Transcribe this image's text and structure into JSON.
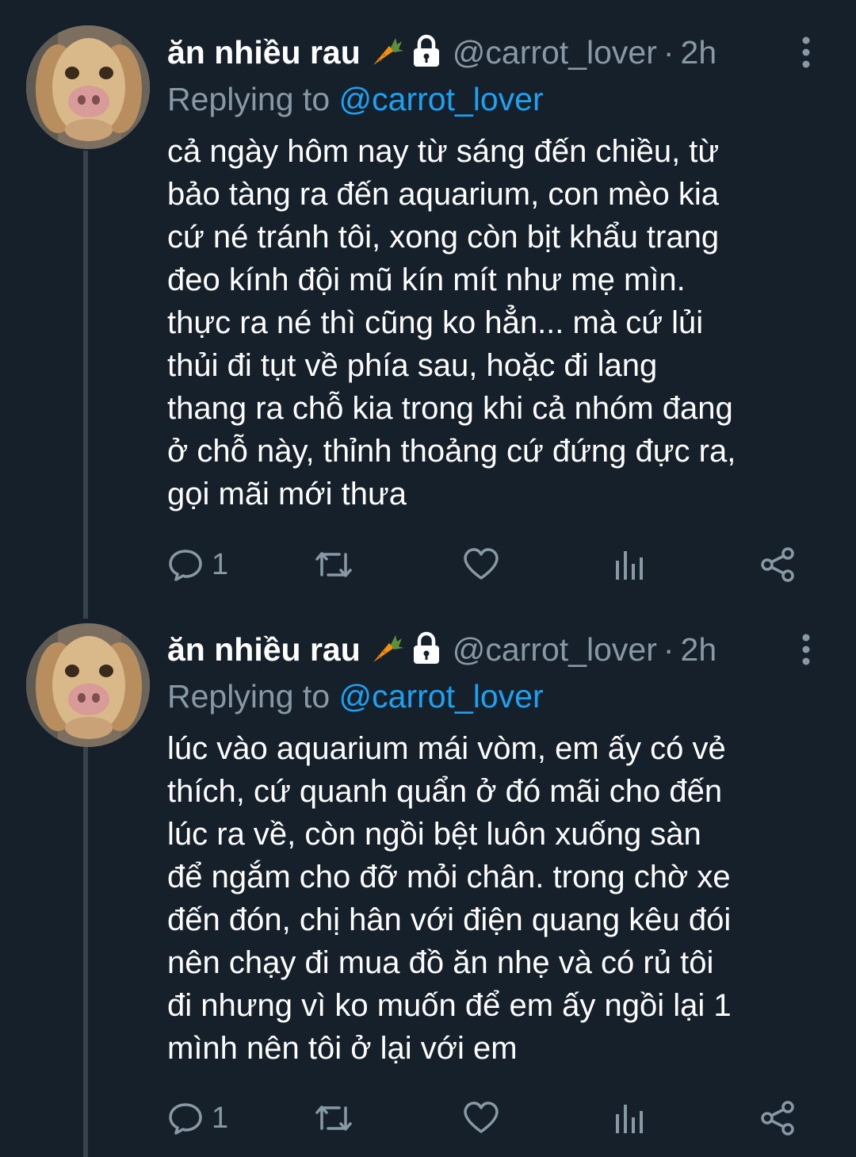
{
  "tweets": [
    {
      "display_name": "ăn nhiều rau",
      "handle": "@carrot_lover",
      "dot": "·",
      "time": "2h",
      "replying_prefix": "Replying to",
      "replying_to": "@carrot_lover",
      "lines": [
        "cả ngày hôm nay từ sáng đến chiều, từ",
        "bảo tàng ra đến aquarium, con mèo kia",
        "cứ né tránh tôi, xong còn bịt khẩu trang",
        "đeo kính đội mũ kín mít như mẹ mìn.",
        "thực ra né thì cũng ko hẳn... mà cứ lủi",
        "thủi đi tụt về phía sau, hoặc đi lang",
        "thang ra chỗ kia trong khi cả nhóm đang",
        "ở chỗ này, thỉnh thoảng cứ đứng đực ra,",
        "gọi mãi mới thưa"
      ],
      "reply_count": "1"
    },
    {
      "display_name": "ăn nhiều rau",
      "handle": "@carrot_lover",
      "dot": "·",
      "time": "2h",
      "replying_prefix": "Replying to",
      "replying_to": "@carrot_lover",
      "lines": [
        "lúc vào aquarium mái vòm, em ấy có vẻ",
        "thích, cứ quanh quẩn ở đó mãi cho đến",
        "lúc ra về, còn ngồi bệt luôn xuống sàn",
        "để ngắm cho đỡ mỏi chân. trong chờ xe",
        "đến đón, chị hân với điện quang kêu đói",
        "nên chạy đi mua đồ ăn nhẹ và có rủ tôi",
        "đi nhưng vì ko muốn để em ấy ngồi lại 1",
        "mình nên tôi ở lại với em"
      ],
      "reply_count": "1"
    }
  ],
  "icons": {
    "name_emoji_1": "carrot-icon",
    "name_emoji_2": "lock-icon",
    "more": "more-vertical-icon",
    "reply": "reply-icon",
    "retweet": "retweet-icon",
    "like": "heart-icon",
    "analytics": "analytics-icon",
    "share": "share-icon"
  },
  "colors": {
    "background": "#15202b",
    "text_primary": "#ffffff",
    "text_secondary": "#8899a6",
    "accent": "#1da1f2",
    "thread_line": "#38444d"
  }
}
